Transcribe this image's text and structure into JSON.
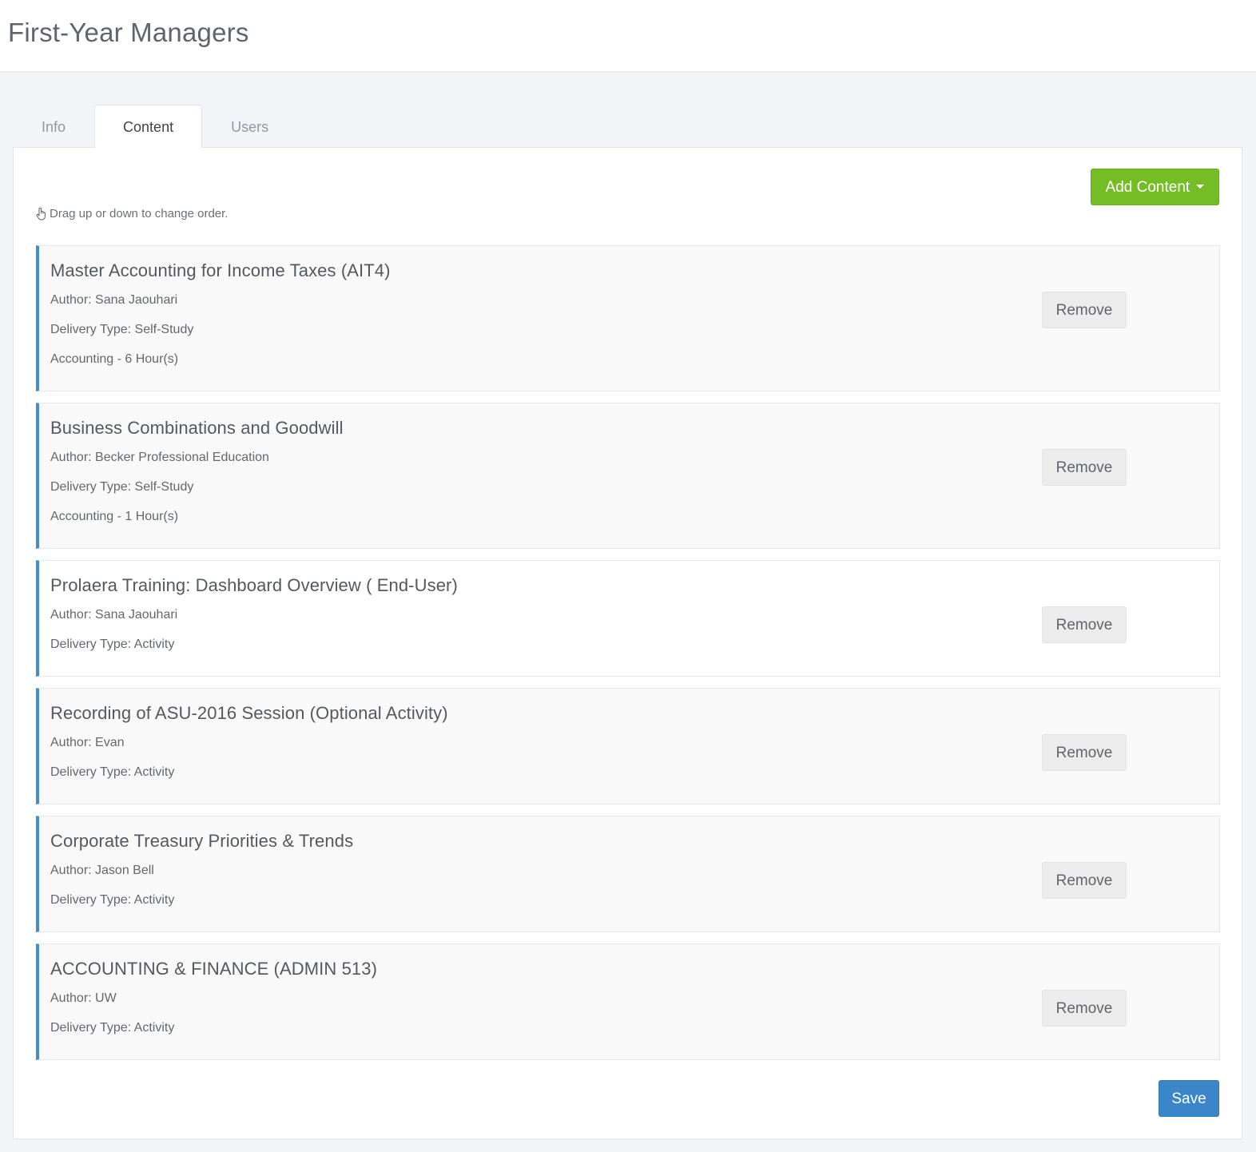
{
  "page": {
    "title": "First-Year Managers"
  },
  "tabs": [
    {
      "label": "Info",
      "active": false
    },
    {
      "label": "Content",
      "active": true
    },
    {
      "label": "Users",
      "active": false
    }
  ],
  "toolbar": {
    "add_content_label": "Add Content",
    "hint_text": "Drag up or down to change order.",
    "hint_icon": "hand-pointer-icon"
  },
  "items": [
    {
      "title": "Master Accounting for Income Taxes (AIT4)",
      "author": "Author: Sana Jaouhari",
      "delivery": "Delivery Type: Self-Study",
      "credits": "Accounting - 6 Hour(s)",
      "remove_label": "Remove"
    },
    {
      "title": "Business Combinations and Goodwill",
      "author": "Author: Becker Professional Education",
      "delivery": "Delivery Type: Self-Study",
      "credits": "Accounting - 1 Hour(s)",
      "remove_label": "Remove"
    },
    {
      "title": "Prolaera Training: Dashboard Overview ( End-User)",
      "author": "Author: Sana Jaouhari",
      "delivery": "Delivery Type: Activity",
      "remove_label": "Remove"
    },
    {
      "title": "Recording of ASU-2016 Session (Optional Activity)",
      "author": "Author: Evan",
      "delivery": "Delivery Type: Activity",
      "remove_label": "Remove"
    },
    {
      "title": "Corporate Treasury Priorities & Trends",
      "author": "Author: Jason Bell",
      "delivery": "Delivery Type: Activity",
      "remove_label": "Remove"
    },
    {
      "title": "ACCOUNTING & FINANCE (ADMIN 513)",
      "author": "Author: UW",
      "delivery": "Delivery Type: Activity",
      "remove_label": "Remove"
    }
  ],
  "footer": {
    "save_label": "Save"
  },
  "colors": {
    "accent_green": "#74bd24",
    "accent_blue": "#3a86c8",
    "item_border": "#3f8fcf"
  }
}
